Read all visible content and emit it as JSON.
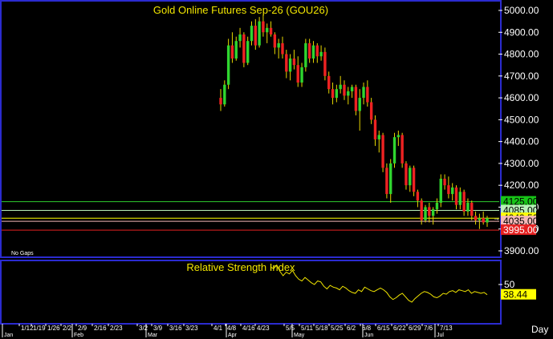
{
  "chart_data": {
    "type": "candlestick",
    "title": "Gold Online Futures Sep-26  (GOU26)",
    "subplot_title": "Relative Strength Index",
    "note": "No Gaps",
    "period": "Day",
    "price_axis": {
      "min": 3900,
      "max": 5000,
      "ticks": [
        "5000.00",
        "4900.00",
        "4800.00",
        "4700.00",
        "4600.00",
        "4500.00",
        "4400.00",
        "4300.00",
        "4200.00",
        "4100.00",
        "4000.00",
        "3900.00"
      ]
    },
    "rsi_axis": {
      "ticks": [
        "50"
      ],
      "current": "38.44"
    },
    "levels": [
      {
        "value": 4125,
        "label": "4125.00",
        "line": "#2ecc2e",
        "bg": "#18c418",
        "fg": "#000000"
      },
      {
        "value": 4085,
        "label": "4085.00",
        "line": "#b8f0b8",
        "bg": "#b8f0b8",
        "fg": "#000000"
      },
      {
        "value": 4049.5,
        "label": "4049.50",
        "line": "#ffff00",
        "bg": "#ffff00",
        "fg": "#000000"
      },
      {
        "value": 4035,
        "label": "4035.00",
        "line": "#f4b8b8",
        "bg": "#f4b8b8",
        "fg": "#000000"
      },
      {
        "value": 3995,
        "label": "3995.00",
        "line": "#e52020",
        "bg": "#e52020",
        "fg": "#ffffff"
      }
    ],
    "x_ticks": [
      "1/12",
      "1/19",
      "1/26",
      "2/2",
      "2/9",
      "2/16",
      "2/23",
      "3/2",
      "3/9",
      "3/16",
      "3/23",
      "4/1",
      "4/8",
      "4/16",
      "4/23",
      "5/5",
      "5/11",
      "5/18",
      "5/25",
      "6/2",
      "6/8",
      "6/15",
      "6/22",
      "6/29",
      "7/6",
      "7/13"
    ],
    "months": [
      "Jan",
      "Feb",
      "Mar",
      "Apr",
      "May",
      "Jun",
      "Jul"
    ],
    "series": [
      {
        "type": "ohlc",
        "rows": [
          [
            4600,
            4640,
            4540,
            4570
          ],
          [
            4570,
            4680,
            4560,
            4660
          ],
          [
            4660,
            4870,
            4640,
            4840
          ],
          [
            4840,
            4900,
            4760,
            4780
          ],
          [
            4780,
            4880,
            4770,
            4860
          ],
          [
            4860,
            4920,
            4830,
            4890
          ],
          [
            4890,
            4900,
            4740,
            4760
          ],
          [
            4760,
            4880,
            4750,
            4860
          ],
          [
            4860,
            4950,
            4840,
            4930
          ],
          [
            4930,
            4960,
            4820,
            4840
          ],
          [
            4840,
            4970,
            4830,
            4950
          ],
          [
            4950,
            4980,
            4880,
            4900
          ],
          [
            4900,
            4940,
            4850,
            4920
          ],
          [
            4920,
            4950,
            4880,
            4890
          ],
          [
            4890,
            4900,
            4800,
            4830
          ],
          [
            4830,
            4870,
            4780,
            4850
          ],
          [
            4850,
            4880,
            4780,
            4800
          ],
          [
            4800,
            4820,
            4690,
            4720
          ],
          [
            4720,
            4800,
            4680,
            4780
          ],
          [
            4780,
            4820,
            4730,
            4750
          ],
          [
            4750,
            4790,
            4650,
            4670
          ],
          [
            4670,
            4760,
            4650,
            4740
          ],
          [
            4740,
            4870,
            4720,
            4850
          ],
          [
            4850,
            4870,
            4760,
            4780
          ],
          [
            4780,
            4860,
            4760,
            4840
          ],
          [
            4840,
            4850,
            4760,
            4790
          ],
          [
            4790,
            4840,
            4770,
            4810
          ],
          [
            4810,
            4830,
            4680,
            4700
          ],
          [
            4700,
            4720,
            4620,
            4640
          ],
          [
            4640,
            4670,
            4570,
            4600
          ],
          [
            4600,
            4660,
            4580,
            4640
          ],
          [
            4640,
            4700,
            4620,
            4660
          ],
          [
            4660,
            4680,
            4590,
            4610
          ],
          [
            4610,
            4650,
            4570,
            4630
          ],
          [
            4630,
            4660,
            4600,
            4650
          ],
          [
            4650,
            4660,
            4520,
            4540
          ],
          [
            4540,
            4640,
            4450,
            4600
          ],
          [
            4600,
            4670,
            4570,
            4650
          ],
          [
            4650,
            4680,
            4560,
            4580
          ],
          [
            4580,
            4600,
            4480,
            4500
          ],
          [
            4500,
            4520,
            4380,
            4410
          ],
          [
            4410,
            4450,
            4350,
            4430
          ],
          [
            4430,
            4440,
            4260,
            4280
          ],
          [
            4280,
            4300,
            4140,
            4160
          ],
          [
            4160,
            4320,
            4120,
            4300
          ],
          [
            4300,
            4440,
            4280,
            4420
          ],
          [
            4420,
            4450,
            4380,
            4430
          ],
          [
            4430,
            4440,
            4280,
            4300
          ],
          [
            4300,
            4310,
            4180,
            4200
          ],
          [
            4200,
            4290,
            4170,
            4280
          ],
          [
            4280,
            4290,
            4150,
            4170
          ],
          [
            4170,
            4180,
            4100,
            4130
          ],
          [
            4130,
            4140,
            4020,
            4040
          ],
          [
            4040,
            4110,
            4030,
            4100
          ],
          [
            4100,
            4120,
            4030,
            4060
          ],
          [
            4060,
            4100,
            4020,
            4090
          ],
          [
            4090,
            4140,
            4070,
            4120
          ],
          [
            4120,
            4250,
            4100,
            4230
          ],
          [
            4230,
            4250,
            4180,
            4200
          ],
          [
            4200,
            4240,
            4140,
            4160
          ],
          [
            4160,
            4210,
            4130,
            4190
          ],
          [
            4190,
            4200,
            4090,
            4110
          ],
          [
            4110,
            4190,
            4090,
            4170
          ],
          [
            4170,
            4180,
            4060,
            4080
          ],
          [
            4080,
            4140,
            4060,
            4120
          ],
          [
            4120,
            4130,
            4040,
            4060
          ],
          [
            4060,
            4080,
            4020,
            4040
          ],
          [
            4040,
            4070,
            4000,
            4050
          ],
          [
            4050,
            4080,
            4020,
            4030
          ],
          [
            4030,
            4060,
            4010,
            4049.5
          ]
        ]
      },
      {
        "name": "Relative Strength Index",
        "values": [
          70,
          68,
          72,
          65,
          60,
          64,
          62,
          66,
          60,
          56,
          54,
          58,
          55,
          52,
          50,
          54,
          53,
          48,
          45,
          49,
          47,
          46,
          44,
          48,
          46,
          43,
          41,
          40,
          44,
          42,
          47,
          45,
          43,
          42,
          44,
          46,
          44,
          41,
          36,
          33,
          35,
          38,
          40,
          36,
          32,
          30,
          34,
          37,
          40,
          42,
          41,
          39,
          36,
          35,
          37,
          40,
          39,
          42,
          43,
          41,
          44,
          43,
          42,
          44,
          40,
          42,
          41,
          40,
          41,
          38.44
        ]
      }
    ]
  }
}
